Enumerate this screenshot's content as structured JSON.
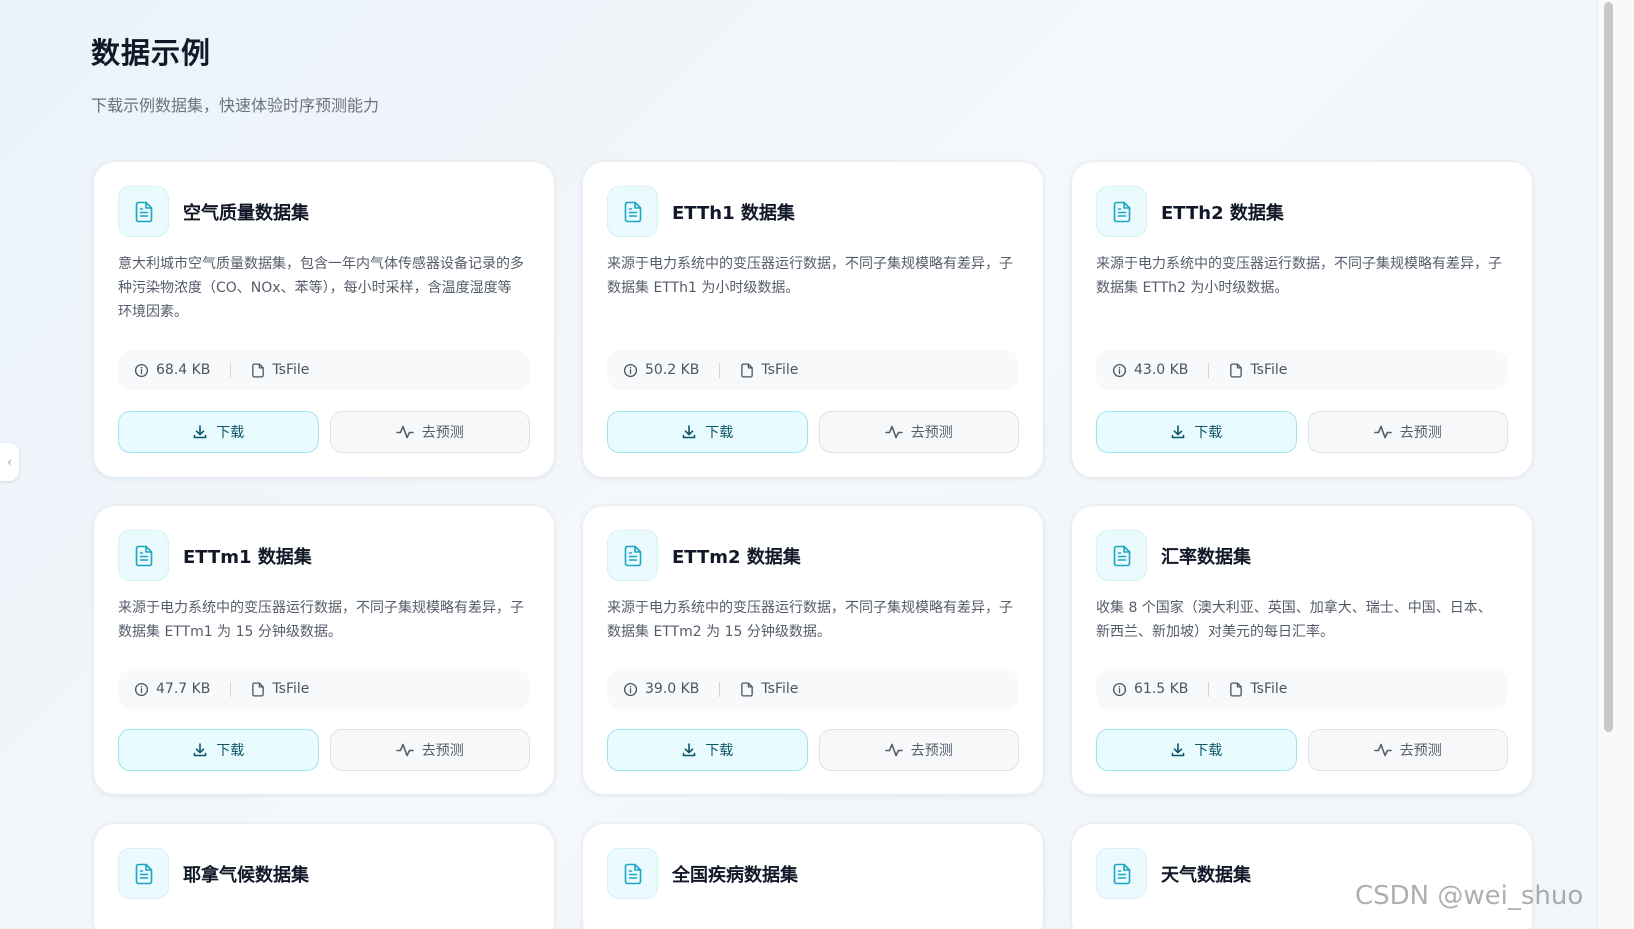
{
  "page": {
    "title": "数据示例",
    "subtitle": "下载示例数据集，快速体验时序预测能力"
  },
  "labels": {
    "download": "下载",
    "predict": "去预测"
  },
  "side_toggle": "‹",
  "cards": [
    {
      "title": "空气质量数据集",
      "description": "意大利城市空气质量数据集，包含一年内气体传感器设备记录的多种污染物浓度（CO、NOx、苯等），每小时采样，含温度湿度等环境因素。",
      "size": "68.4 KB",
      "format": "TsFile"
    },
    {
      "title": "ETTh1 数据集",
      "description": "来源于电力系统中的变压器运行数据，不同子集规模略有差异，子数据集 ETTh1 为小时级数据。",
      "size": "50.2 KB",
      "format": "TsFile"
    },
    {
      "title": "ETTh2 数据集",
      "description": "来源于电力系统中的变压器运行数据，不同子集规模略有差异，子数据集 ETTh2 为小时级数据。",
      "size": "43.0 KB",
      "format": "TsFile"
    },
    {
      "title": "ETTm1 数据集",
      "description": "来源于电力系统中的变压器运行数据，不同子集规模略有差异，子数据集 ETTm1 为 15 分钟级数据。",
      "size": "47.7 KB",
      "format": "TsFile"
    },
    {
      "title": "ETTm2 数据集",
      "description": "来源于电力系统中的变压器运行数据，不同子集规模略有差异，子数据集 ETTm2 为 15 分钟级数据。",
      "size": "39.0 KB",
      "format": "TsFile"
    },
    {
      "title": "汇率数据集",
      "description": "收集 8 个国家（澳大利亚、英国、加拿大、瑞士、中国、日本、新西兰、新加坡）对美元的每日汇率。",
      "size": "61.5 KB",
      "format": "TsFile"
    },
    {
      "title": "耶拿气候数据集"
    },
    {
      "title": "全国疾病数据集"
    },
    {
      "title": "天气数据集"
    }
  ],
  "watermark": "CSDN @wei_shuo",
  "colors": {
    "accent": "#14a3c0",
    "download_bg": "#e8fbfe",
    "download_border": "#9fe4f0"
  }
}
